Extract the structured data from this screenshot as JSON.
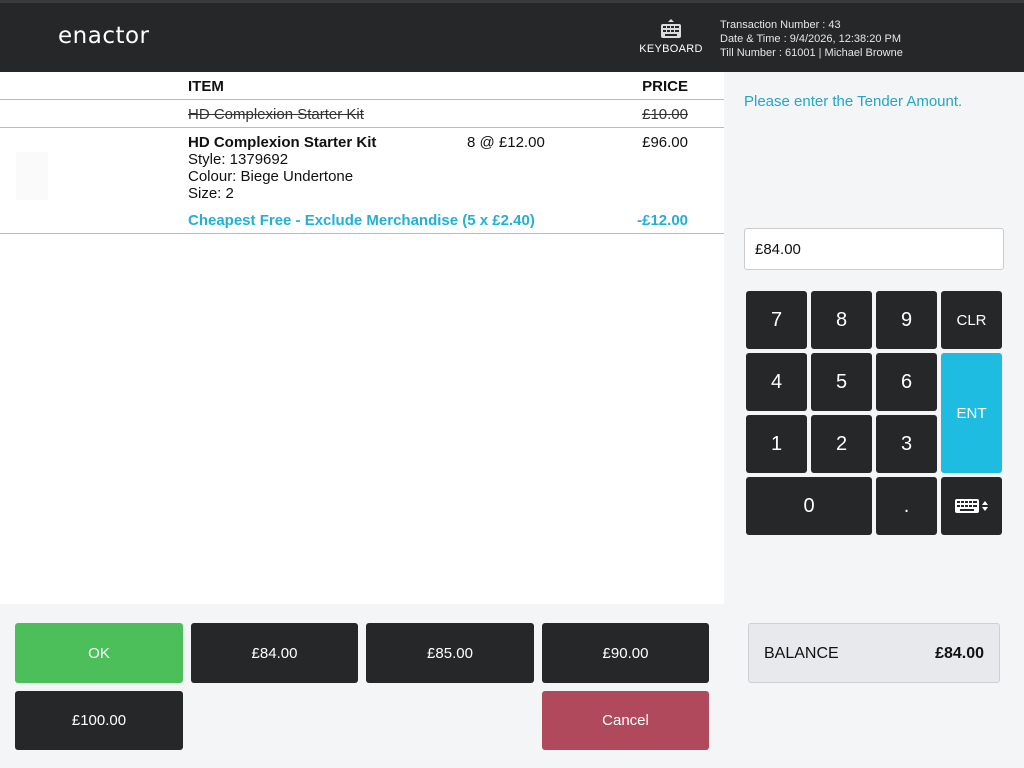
{
  "header": {
    "logo_text": "enactor",
    "keyboard_label": "KEYBOARD",
    "transaction_line": "Transaction Number : 43",
    "datetime_line": "Date & Time : 9/4/2026, 12:38:20 PM",
    "till_line": "Till Number : 61001  |  Michael Browne"
  },
  "list": {
    "col_item": "ITEM",
    "col_price": "PRICE",
    "voided_item": {
      "name": "HD Complexion Starter Kit",
      "price": "£10.00"
    },
    "item": {
      "name": "HD Complexion Starter Kit",
      "qty": "8 @ £12.00",
      "price": "£96.00",
      "style": "Style: 1379692",
      "colour": "Colour: Biege Undertone",
      "size": "Size: 2",
      "promo": "Cheapest Free - Exclude Merchandise (5 x £2.40)",
      "promo_amount": "-£12.00"
    }
  },
  "tender": {
    "prompt": "Please enter the Tender Amount.",
    "input_value": "£84.00"
  },
  "keypad": {
    "k7": "7",
    "k8": "8",
    "k9": "9",
    "clr": "CLR",
    "k4": "4",
    "k5": "5",
    "k6": "6",
    "ent": "ENT",
    "k1": "1",
    "k2": "2",
    "k3": "3",
    "k0": "0",
    "dot": ".",
    "keyboard_toggle_icon": "keyboard-toggle-icon"
  },
  "actions": {
    "ok": "OK",
    "quick1": "£84.00",
    "quick2": "£85.00",
    "quick3": "£90.00",
    "quick4": "£100.00",
    "cancel": "Cancel"
  },
  "balance": {
    "label": "BALANCE",
    "value": "£84.00"
  },
  "colors": {
    "header_bg": "#262728",
    "accent": "#1ebce0",
    "ok": "#4cbf5b",
    "cancel": "#b0495c",
    "promo_text": "#23b0d6"
  }
}
